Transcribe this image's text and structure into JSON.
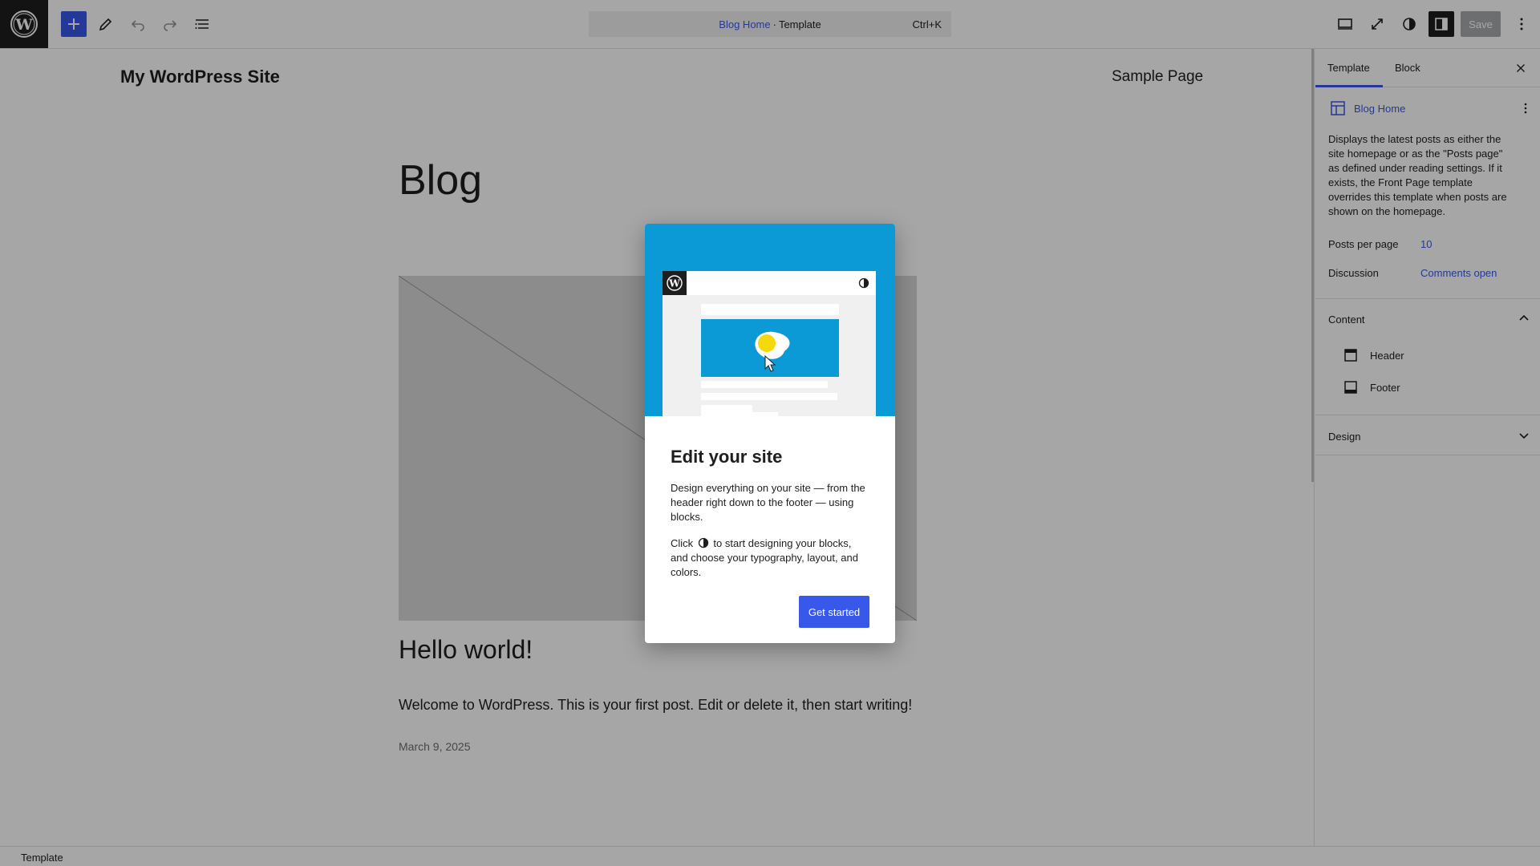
{
  "toolbar": {
    "logo": "wordpress-logo",
    "icons": [
      "plus-icon",
      "pencil-icon",
      "undo-icon",
      "redo-icon",
      "list-view-icon"
    ],
    "command_bar": {
      "template_name": "Blog Home",
      "separator": "·",
      "template_type": "Template",
      "shortcut": "Ctrl+K"
    },
    "right_icons": [
      "desktop-view-icon",
      "fullscreen-icon",
      "styles-icon",
      "settings-sidebar-icon"
    ],
    "save_label": "Save",
    "more_icon": "more-vertical-icon",
    "accent_color": "#3858e9"
  },
  "canvas": {
    "site_title": "My WordPress Site",
    "nav_item": "Sample Page",
    "page_heading": "Blog",
    "post": {
      "title": "Hello world!",
      "excerpt": "Welcome to WordPress. This is your first post. Edit or delete it, then start writing!",
      "date": "March 9, 2025"
    }
  },
  "sidebar": {
    "tabs": [
      {
        "label": "Template",
        "active": true
      },
      {
        "label": "Block",
        "active": false
      }
    ],
    "template_title": "Blog Home",
    "description": "Displays the latest posts as either the site homepage or as the \"Posts page\" as defined under reading settings. If it exists, the Front Page template overrides this template when posts are shown on the homepage.",
    "posts_per_page_label": "Posts per page",
    "posts_per_page_value": "10",
    "discussion_label": "Discussion",
    "discussion_value": "Comments open",
    "content_section": {
      "title": "Content",
      "expanded": true,
      "items": [
        {
          "label": "Header",
          "icon": "template-part-header-icon"
        },
        {
          "label": "Footer",
          "icon": "template-part-footer-icon"
        }
      ]
    },
    "design_section": {
      "title": "Design",
      "expanded": false
    }
  },
  "footer": {
    "label": "Template"
  },
  "modal": {
    "title": "Edit your site",
    "paragraph1": "Design everything on your site — from the header right down to the footer — using blocks.",
    "paragraph2_before": "Click",
    "paragraph2_after": "to start designing your blocks, and choose your typography, layout, and colors.",
    "button_label": "Get started",
    "illustration_color": "#0b9ad6"
  }
}
